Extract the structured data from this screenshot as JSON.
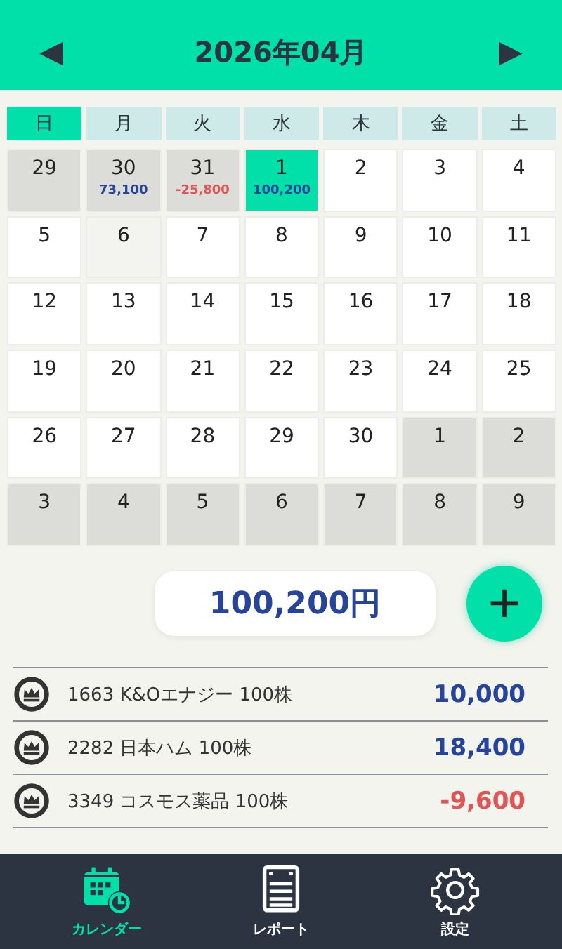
{
  "header": {
    "prev": "◀",
    "title": "2026年04月",
    "next": "▶"
  },
  "weekdays": [
    {
      "label": "日",
      "selected": true
    },
    {
      "label": "月",
      "selected": false
    },
    {
      "label": "火",
      "selected": false
    },
    {
      "label": "水",
      "selected": false
    },
    {
      "label": "木",
      "selected": false
    },
    {
      "label": "金",
      "selected": false
    },
    {
      "label": "土",
      "selected": false
    }
  ],
  "days": [
    {
      "day": "29",
      "kind": "outside"
    },
    {
      "day": "30",
      "kind": "outside",
      "amount": "73,100",
      "color": "#26449a"
    },
    {
      "day": "31",
      "kind": "outside",
      "amount": "-25,800",
      "color": "#e05555"
    },
    {
      "day": "1",
      "kind": "selected",
      "amount": "100,200",
      "color": "#26449a"
    },
    {
      "day": "2",
      "kind": "month"
    },
    {
      "day": "3",
      "kind": "month"
    },
    {
      "day": "4",
      "kind": "month"
    },
    {
      "day": "5",
      "kind": "month"
    },
    {
      "day": "6",
      "kind": "shaded"
    },
    {
      "day": "7",
      "kind": "month"
    },
    {
      "day": "8",
      "kind": "month"
    },
    {
      "day": "9",
      "kind": "month"
    },
    {
      "day": "10",
      "kind": "month"
    },
    {
      "day": "11",
      "kind": "month"
    },
    {
      "day": "12",
      "kind": "month"
    },
    {
      "day": "13",
      "kind": "month"
    },
    {
      "day": "14",
      "kind": "month"
    },
    {
      "day": "15",
      "kind": "month"
    },
    {
      "day": "16",
      "kind": "month"
    },
    {
      "day": "17",
      "kind": "month"
    },
    {
      "day": "18",
      "kind": "month"
    },
    {
      "day": "19",
      "kind": "month"
    },
    {
      "day": "20",
      "kind": "month"
    },
    {
      "day": "21",
      "kind": "month"
    },
    {
      "day": "22",
      "kind": "month"
    },
    {
      "day": "23",
      "kind": "month"
    },
    {
      "day": "24",
      "kind": "month"
    },
    {
      "day": "25",
      "kind": "month"
    },
    {
      "day": "26",
      "kind": "month"
    },
    {
      "day": "27",
      "kind": "month"
    },
    {
      "day": "28",
      "kind": "month"
    },
    {
      "day": "29",
      "kind": "month"
    },
    {
      "day": "30",
      "kind": "month"
    },
    {
      "day": "1",
      "kind": "outside"
    },
    {
      "day": "2",
      "kind": "outside"
    },
    {
      "day": "3",
      "kind": "outside"
    },
    {
      "day": "4",
      "kind": "outside"
    },
    {
      "day": "5",
      "kind": "outside"
    },
    {
      "day": "6",
      "kind": "outside"
    },
    {
      "day": "7",
      "kind": "outside"
    },
    {
      "day": "8",
      "kind": "outside"
    },
    {
      "day": "9",
      "kind": "outside"
    }
  ],
  "total": "100,200円",
  "add_button": "+",
  "entries": [
    {
      "name": "1663 K&Oエナジー 100株",
      "amount": "10,000",
      "color": "#26449a"
    },
    {
      "name": "2282 日本ハム 100株",
      "amount": "18,400",
      "color": "#26449a"
    },
    {
      "name": "3349 コスモス薬品 100株",
      "amount": "-9,600",
      "color": "#e05555"
    }
  ],
  "tabs": [
    {
      "label": "カレンダー",
      "kind": "calendar",
      "selected": true
    },
    {
      "label": "レポート",
      "kind": "report",
      "selected": false
    },
    {
      "label": "設定",
      "kind": "settings",
      "selected": false
    }
  ]
}
